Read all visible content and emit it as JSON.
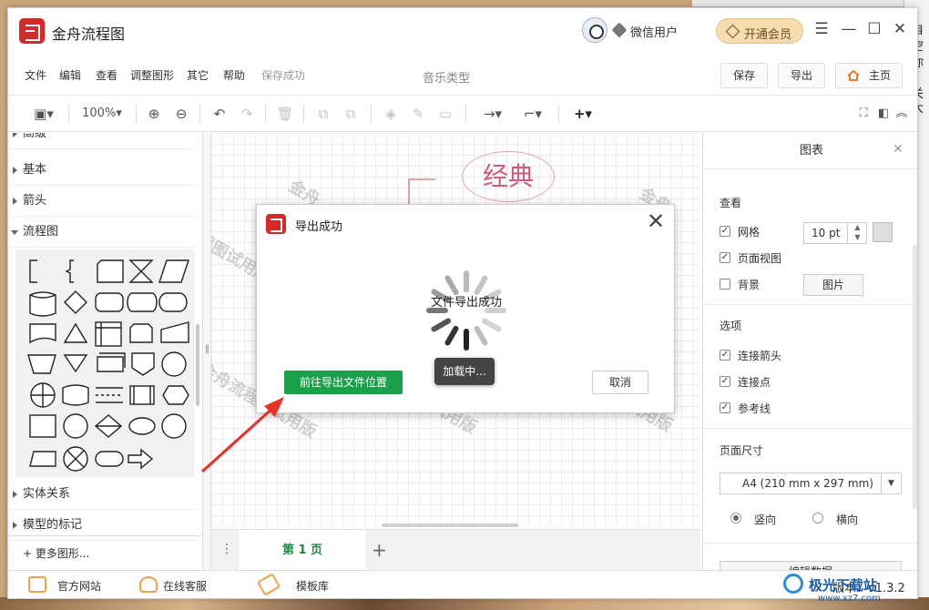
{
  "window": {
    "title": "金舟流程图"
  },
  "user": {
    "name": "微信用户",
    "vip_label": "开通会员"
  },
  "menu": {
    "items": [
      "文件",
      "编辑",
      "查看",
      "调整图形",
      "其它",
      "帮助"
    ],
    "status": "保存成功",
    "doc_title": "音乐类型",
    "save": "保存",
    "export": "导出",
    "home": "主页"
  },
  "toolbar": {
    "zoom": "100%"
  },
  "left_panel": {
    "partial_top": "高级",
    "categories": [
      "基本",
      "箭头",
      "流程图",
      "实体关系",
      "模型的标记"
    ],
    "more": "+ 更多图形..."
  },
  "canvas": {
    "shape_text": "经典",
    "watermark": "金舟流程图试用版",
    "watermark_short": "金舟",
    "watermark_tail": "用版",
    "watermark_tail2": "试用版"
  },
  "pages": {
    "current": "第 1 页"
  },
  "right_panel": {
    "title": "图表",
    "view_section": "查看",
    "grid": "网格",
    "grid_size": "10 pt",
    "page_view": "页面视图",
    "background": "背景",
    "image_btn": "图片",
    "options_section": "选项",
    "connect_arrows": "连接箭头",
    "connect_points": "连接点",
    "guides": "参考线",
    "page_size_section": "页面尺寸",
    "paper": "A4 (210 mm x 297 mm)",
    "portrait": "竖向",
    "landscape": "横向",
    "edit_data": "编辑数据"
  },
  "status_bar": {
    "website": "官方网站",
    "support": "在线客服",
    "templates": "模板库",
    "version": "版本：v1.3.2"
  },
  "dialog": {
    "title": "导出成功",
    "message": "文件导出成功",
    "loading": "加载中...",
    "goto": "前往导出文件位置",
    "cancel": "取消"
  },
  "desktop": {
    "side_chars": [
      "自",
      "空",
      "你",
      "，",
      "关",
      "大"
    ],
    "brand": "极光下载站",
    "site": "www.xz7.com"
  },
  "colors": {
    "brand_red": "#d62a2a",
    "green": "#19a24a",
    "vip_gold": "#f6dcae"
  }
}
